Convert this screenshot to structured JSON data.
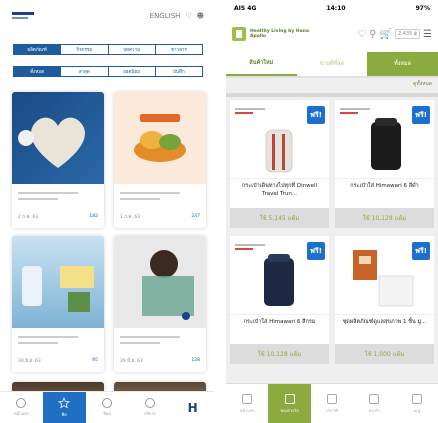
{
  "left": {
    "top_right_text": "ENGLISH",
    "segment_row1": [
      "ผลิตภัณฑ์",
      "กิจกรรม",
      "บทความ",
      "ข่าวสาร"
    ],
    "segment_row2": [
      "ทั้งหมด",
      "ล่าสุด",
      "ยอดนิยม",
      "บันทึก"
    ],
    "cards": [
      {
        "date": "2 ก.ค. 63",
        "likes": "182"
      },
      {
        "date": "1 ก.ค. 63",
        "likes": "247"
      },
      {
        "date": "30 มิ.ย. 63",
        "likes": "95"
      },
      {
        "date": "29 มิ.ย. 63",
        "likes": "128"
      }
    ],
    "bottom_nav": [
      "หน้าแรก",
      "ฟีด",
      "ช้อป",
      "บริการ",
      "H"
    ]
  },
  "right": {
    "status": {
      "carrier": "AIS 4G",
      "time": "14:10",
      "battery": "97%"
    },
    "brand": "Healthy Living by Hana Apollo",
    "cart_price": "2,435 ฿",
    "tabs": [
      "สินค้าใหม่",
      "ขายดีที่สุด",
      "ทั้งหมด"
    ],
    "sub_link": "ดูทั้งหมด",
    "products": [
      {
        "badge": "ฟรี!",
        "title": "กระเป๋าเดินทางไปทุกที่ Dinwell Travel Trun...",
        "price": "ใช้ 5,145 แต้ม"
      },
      {
        "badge": "ฟรี!",
        "title": "กระเป๋าใส่ Himawari 6 สีดำ",
        "price": "ใช้ 10,128 แต้ม"
      },
      {
        "badge": "ฟรี!",
        "title": "กระเป๋าใส่ Himawari 6 สีกรม",
        "price": "ใช้ 10,128 แต้ม"
      },
      {
        "badge": "ฟรี!",
        "title": "ชุดผลิตภัณฑ์ดูแลสุขภาพ 1 ชิ้น มู...",
        "price": "ใช้ 1,000 แต้ม"
      }
    ],
    "bottom_nav": [
      "หน้าแรก",
      "ของรางวัล",
      "ประวัติ",
      "ตะกร้า",
      "เมนู"
    ]
  },
  "colors": {
    "left_accent": "#1f5c9e",
    "right_accent": "#8cab3e",
    "badge_blue": "#1d6fd0"
  }
}
